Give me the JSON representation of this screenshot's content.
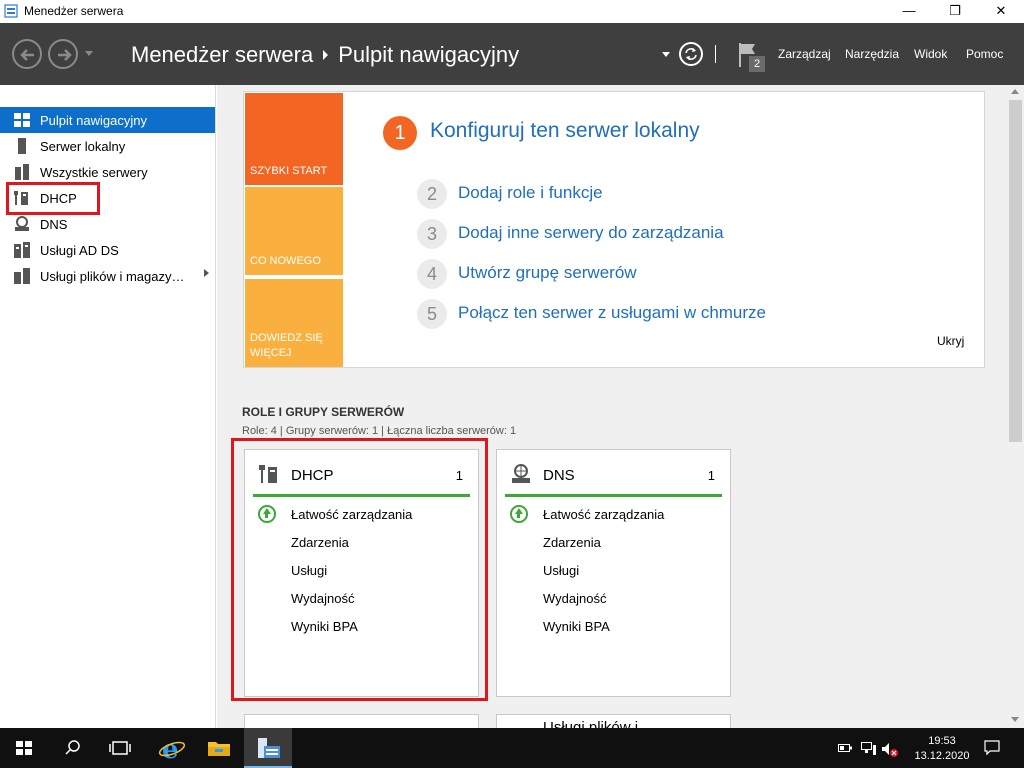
{
  "window": {
    "title": "Menedżer serwera",
    "minimize": "—",
    "restore": "❐",
    "close": "✕"
  },
  "header": {
    "breadcrumb_root": "Menedżer serwera",
    "breadcrumb_current": "Pulpit nawigacyjny",
    "notification_count": "2",
    "menu": [
      "Zarządzaj",
      "Narzędzia",
      "Widok",
      "Pomoc"
    ]
  },
  "sidebar": {
    "items": [
      {
        "label": "Pulpit nawigacyjny",
        "icon": "dashboard-grid-icon",
        "active": true
      },
      {
        "label": "Serwer lokalny",
        "icon": "server-icon"
      },
      {
        "label": "Wszystkie serwery",
        "icon": "servers-icon"
      },
      {
        "label": "DHCP",
        "icon": "dhcp-role-icon"
      },
      {
        "label": "DNS",
        "icon": "dns-role-icon"
      },
      {
        "label": "Usługi AD DS",
        "icon": "ad-ds-icon"
      },
      {
        "label": "Usługi plików i magazy…",
        "icon": "file-services-icon"
      }
    ]
  },
  "welcome": {
    "tiles": [
      "SZYBKI START",
      "CO NOWEGO",
      "DOWIEDZ SIĘ WIĘCEJ"
    ],
    "tile_colors": [
      "#f26522",
      "#f9a93a",
      "#f9a93a"
    ],
    "main_step": {
      "number": "1",
      "label": "Konfiguruj ten serwer lokalny"
    },
    "steps": [
      {
        "number": "2",
        "label": "Dodaj role i funkcje"
      },
      {
        "number": "3",
        "label": "Dodaj inne serwery do zarządzania"
      },
      {
        "number": "4",
        "label": "Utwórz grupę serwerów"
      },
      {
        "number": "5",
        "label": "Połącz ten serwer z usługami w chmurze"
      }
    ],
    "hide_label": "Ukryj"
  },
  "roles": {
    "title": "ROLE I GRUPY SERWERÓW",
    "subtitle": "Role: 4 | Grupy serwerów: 1 | Łączna liczba serwerów: 1",
    "cards": [
      {
        "title": "DHCP",
        "count": "1",
        "rows": [
          "Łatwość zarządzania",
          "Zdarzenia",
          "Usługi",
          "Wydajność",
          "Wyniki BPA"
        ]
      },
      {
        "title": "DNS",
        "count": "1",
        "rows": [
          "Łatwość zarządzania",
          "Zdarzenia",
          "Usługi",
          "Wydajność",
          "Wyniki BPA"
        ]
      }
    ],
    "partial_card_text": "Usługi plików i..."
  },
  "taskbar": {
    "time": "19:53",
    "date": "13.12.2020",
    "apps": [
      "start-icon",
      "search-icon",
      "task-view-icon",
      "internet-explorer-icon",
      "file-explorer-icon",
      "server-manager-icon"
    ]
  },
  "colors": {
    "header_bg": "#3f3f3f",
    "active_nav": "#0d6fc9",
    "link": "#1f6fbd",
    "highlight_box": "#e0161f",
    "status_green": "#3aaa35"
  }
}
